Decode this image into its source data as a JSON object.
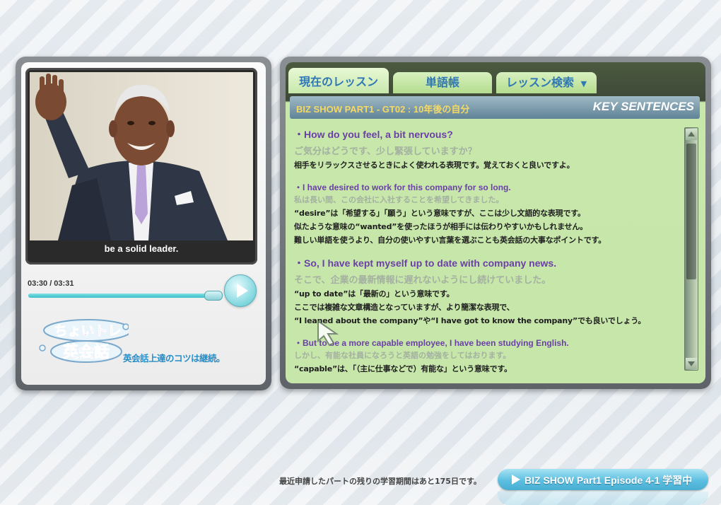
{
  "player": {
    "caption": "be a solid leader.",
    "time": "03:30 / 03:31",
    "progress": 0.99,
    "logo": {
      "title_line1": "ちょいトレ",
      "title_line2": "英会話",
      "tagline": "英会話上達のコツは継続。"
    }
  },
  "tabs": [
    {
      "label": "現在のレッスン",
      "active": true
    },
    {
      "label": "単語帳",
      "active": false
    },
    {
      "label": "レッスン検索",
      "active": false
    }
  ],
  "lesson": {
    "title": "BIZ SHOW PART1 - GT02 : 10年後の自分",
    "section": "KEY SENTENCES",
    "entries": [
      {
        "en": "・How do you feel, a bit nervous?",
        "jp": "ご気分はどうです、少し緊張していますか？",
        "notes": [
          "相手をリラックスさせるときによく使われる表現です。覚えておくと良いですよ。"
        ]
      },
      {
        "en": "・I have desired to work for this company for so long.",
        "jp": "私は長い間、この会社に入社することを希望してきました。",
        "notes": [
          "“desire”は「希望する」「願う」という意味ですが、ここは少し文語的な表現です。",
          "似たような意味の“wanted”を使ったほうが相手には伝わりやすいかもしれません。",
          "難しい単語を使うより、自分の使いやすい言葉を選ぶことも英会話の大事なポイントです。"
        ]
      },
      {
        "en": "・So, I have kept myself up to date with company news.",
        "jp": "そこで、企業の最新情報に遅れないようにし続けていました。",
        "notes": [
          "“up to date”は「最新の」という意味です。",
          "ここでは複雑な文章構造となっていますが、より簡潔な表現で、",
          "“I leaned about the company”や“I have got to know the company”でも良いでしょう。"
        ]
      },
      {
        "en": "・But to be a more capable employee, I have been studying English.",
        "jp": "しかし、有能な社員になろうと英語の勉強をしてはおります。",
        "notes": [
          "“capable”は、「（主に仕事などで）有能な」という意味です。"
        ]
      }
    ]
  },
  "footer": {
    "notice": "最近申請したパートの残りの学習期間はあと175日です。",
    "current_episode": "BIZ SHOW Part1 Episode 4-1 学習中"
  },
  "colors": {
    "accent_cyan": "#5cbfe0",
    "english_text": "#6b3fa8",
    "lesson_title": "#f5d964",
    "tab_text": "#2f78b5"
  },
  "icons": [
    "play-icon",
    "dropdown-arrow-icon",
    "scroll-up-icon",
    "scroll-down-icon",
    "mouse-cursor-icon"
  ]
}
